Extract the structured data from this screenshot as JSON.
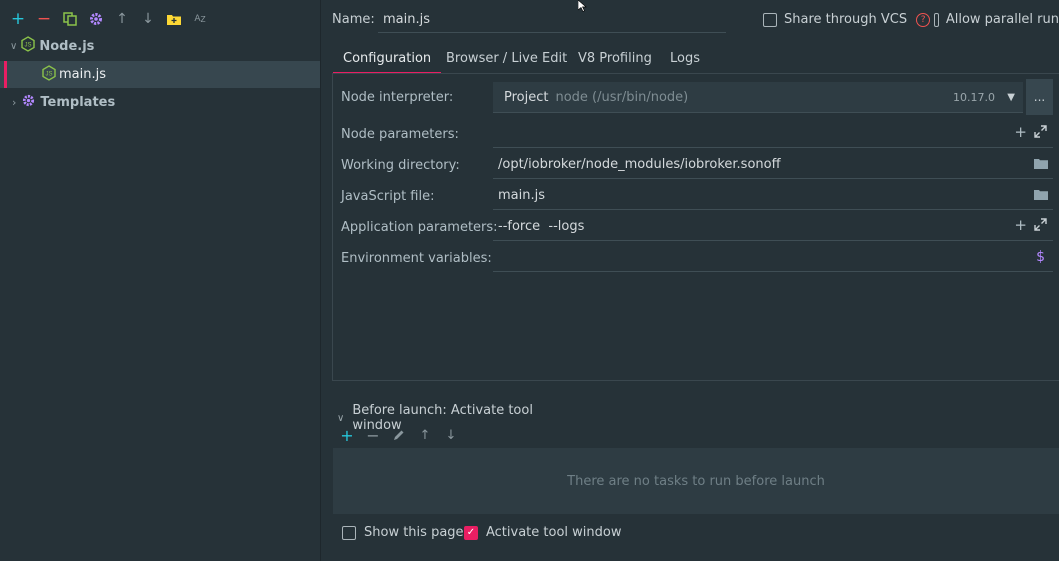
{
  "toolbar": {
    "icons": [
      "add-icon",
      "remove-icon",
      "copy-icon",
      "settings-icon",
      "move-up-icon",
      "move-down-icon",
      "new-folder-icon",
      "sort-alpha-icon"
    ]
  },
  "tree": {
    "group_label": "Node.js",
    "item_label": "main.js",
    "templates_label": "Templates"
  },
  "header": {
    "name_label": "Name:",
    "name_value": "main.js",
    "share_label": "Share through VCS",
    "allow_parallel_label": "Allow parallel run"
  },
  "tabs": [
    {
      "label": "Configuration"
    },
    {
      "label": "Browser / Live Edit"
    },
    {
      "label": "V8 Profiling"
    },
    {
      "label": "Logs"
    }
  ],
  "form": {
    "interpreter_label": "Node interpreter:",
    "interpreter_project": "Project",
    "interpreter_path": "node (/usr/bin/node)",
    "interpreter_version": "10.17.0",
    "browse_label": "...",
    "node_params_label": "Node parameters:",
    "node_params_value": "",
    "working_dir_label": "Working directory:",
    "working_dir_value": "/opt/iobroker/node_modules/iobroker.sonoff",
    "js_file_label": "JavaScript file:",
    "js_file_value": "main.js",
    "app_params_label": "Application parameters:",
    "app_params_value": "--force  --logs",
    "env_vars_label": "Environment variables:",
    "env_vars_value": ""
  },
  "before_launch": {
    "title": "Before launch: Activate tool window",
    "empty_text": "There are no tasks to run before launch"
  },
  "footer": {
    "show_page_label": "Show this page",
    "activate_tool_label": "Activate tool window"
  },
  "colors": {
    "accent": "#e91e63",
    "background": "#263238",
    "panel": "#2e3c43",
    "nodejs_green": "#8bc34a",
    "settings_purple": "#b388ff",
    "add_cyan": "#26c6da",
    "remove_red": "#ef5350",
    "folder_yellow": "#fdd835"
  }
}
